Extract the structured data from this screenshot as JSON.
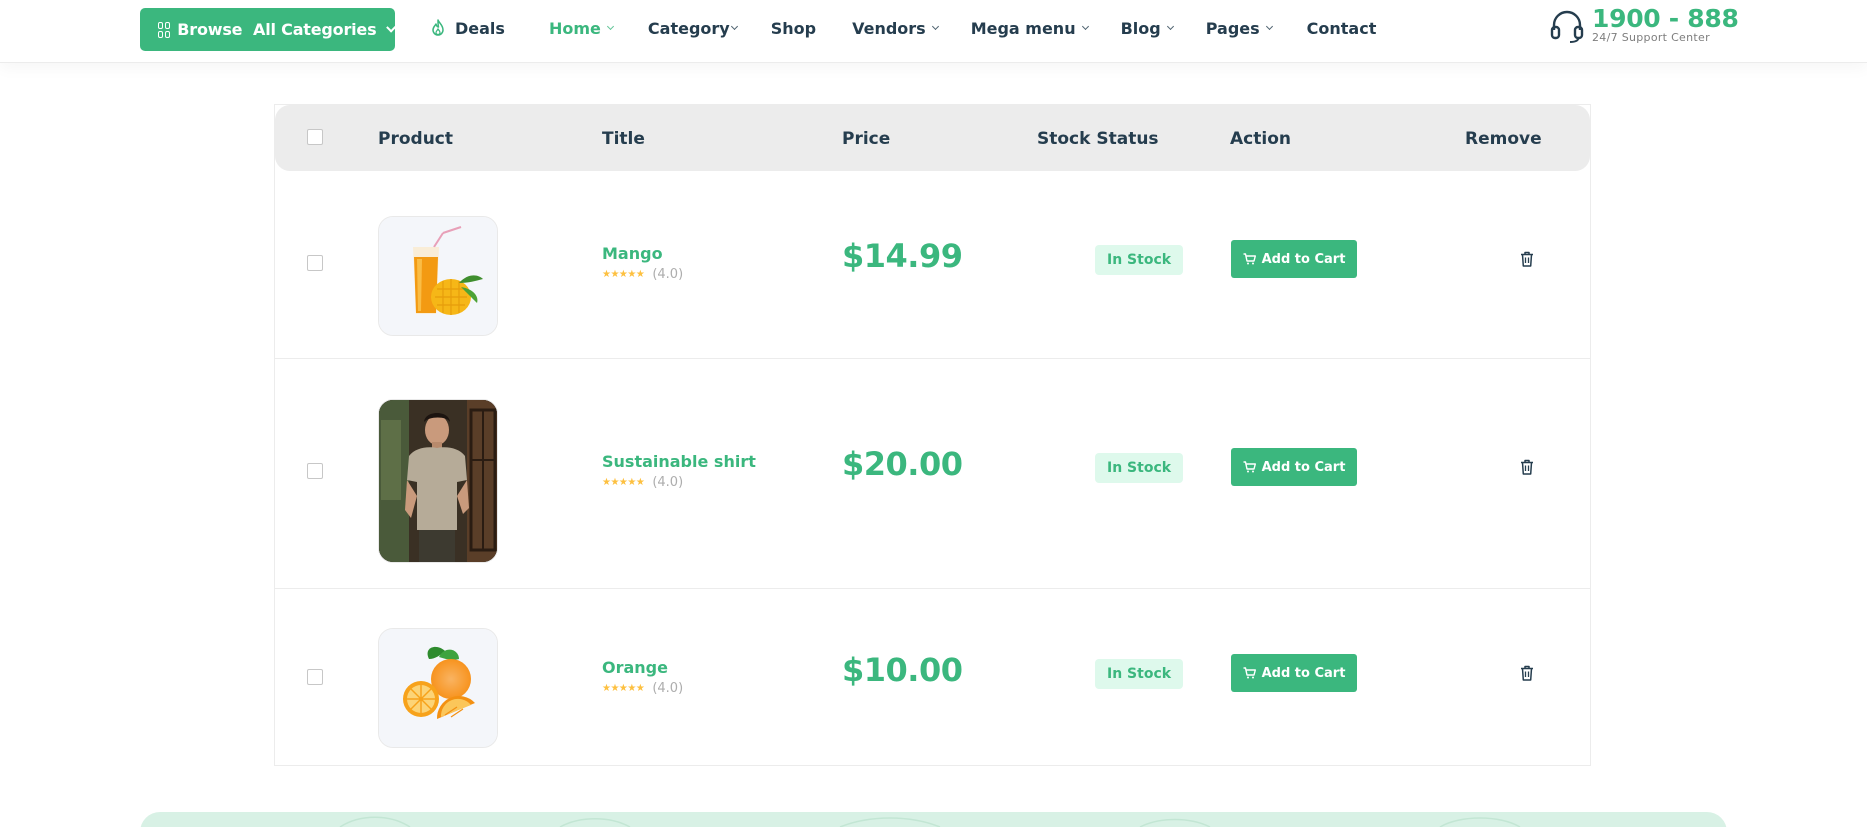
{
  "header": {
    "browse_label": "Browse  All Categories",
    "deals_label": "Deals",
    "nav": [
      {
        "label": "Home",
        "dropdown": true,
        "active": true
      },
      {
        "label": "Category",
        "dropdown": true,
        "active": false
      },
      {
        "label": "Shop",
        "dropdown": false,
        "active": false
      },
      {
        "label": "Vendors",
        "dropdown": true,
        "active": false
      },
      {
        "label": "Mega menu",
        "dropdown": true,
        "active": false
      },
      {
        "label": "Blog",
        "dropdown": true,
        "active": false
      },
      {
        "label": "Pages",
        "dropdown": true,
        "active": false
      },
      {
        "label": "Contact",
        "dropdown": false,
        "active": false
      }
    ],
    "support_phone": "1900 - 888",
    "support_caption": "24/7 Support Center"
  },
  "table": {
    "headers": {
      "product": "Product",
      "title": "Title",
      "price": "Price",
      "stock": "Stock Status",
      "action": "Action",
      "remove": "Remove"
    },
    "rows": [
      {
        "title": "Mango",
        "rating": "(4.0)",
        "stars": "★★★★★",
        "price": "$14.99",
        "stock": "In Stock",
        "action": "Add to Cart",
        "image": "mango-juice-image"
      },
      {
        "title": "Sustainable shirt",
        "rating": "(4.0)",
        "stars": "★★★★★",
        "price": "$20.00",
        "stock": "In Stock",
        "action": "Add to Cart",
        "image": "shirt-model-image"
      },
      {
        "title": "Orange",
        "rating": "(4.0)",
        "stars": "★★★★★",
        "price": "$10.00",
        "stock": "In Stock",
        "action": "Add to Cart",
        "image": "orange-image"
      }
    ]
  },
  "colors": {
    "brand": "#3bb77e",
    "heading": "#253d4e",
    "badge_bg": "#def9ec",
    "header_bg": "#ececec",
    "star": "#fdc040"
  }
}
